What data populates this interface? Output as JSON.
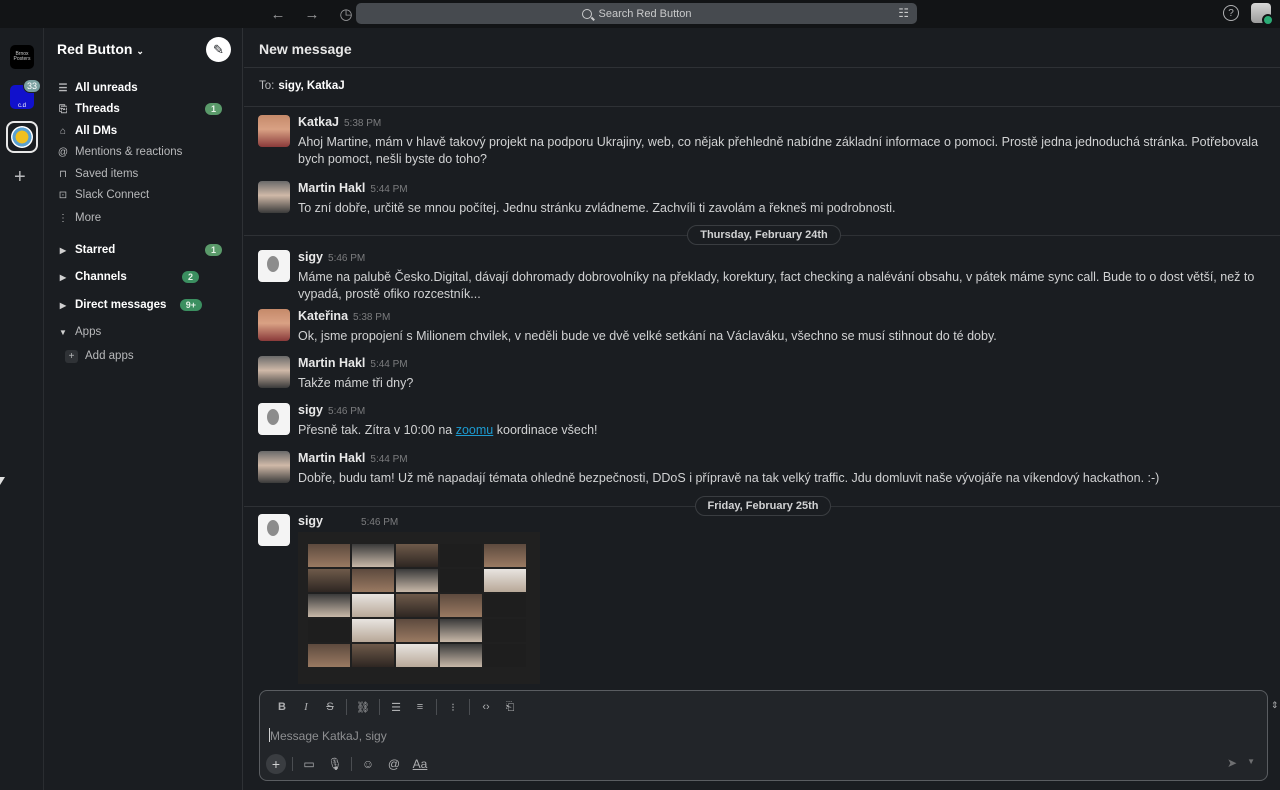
{
  "search": {
    "placeholder": "Search Red Button"
  },
  "workspaces": {
    "badge_count": "33",
    "ws1_text": "Brnox Posters",
    "ws2_text": "c.d"
  },
  "sidebar": {
    "workspace_name": "Red Button",
    "items": [
      {
        "label": "All unreads",
        "icon": "list-icon",
        "bold": true
      },
      {
        "label": "Threads",
        "icon": "threads-icon",
        "bold": true,
        "count": "1"
      },
      {
        "label": "All DMs",
        "icon": "dms-icon",
        "bold": true
      },
      {
        "label": "Mentions & reactions",
        "icon": "at-icon",
        "bold": false
      },
      {
        "label": "Saved items",
        "icon": "bookmark-icon",
        "bold": false
      },
      {
        "label": "Slack Connect",
        "icon": "connect-icon",
        "bold": false
      },
      {
        "label": "More",
        "icon": "more-icon",
        "bold": false
      }
    ],
    "sections": [
      {
        "label": "Starred",
        "count": "1"
      },
      {
        "label": "Channels",
        "count": "2"
      },
      {
        "label": "Direct messages",
        "count": "9+"
      },
      {
        "label": "Apps"
      }
    ],
    "add_apps": "Add apps"
  },
  "main": {
    "title": "New message",
    "to_label": "To:",
    "to_value": "sigy, KatkaJ"
  },
  "messages": [
    {
      "user": "KatkaJ",
      "time": "5:38 PM",
      "text": "Ahoj Martine, mám v hlavě takový projekt na podporu Ukrajiny, web, co nějak přehledně nabídne základní informace o pomoci. Prostě jedna jednoduchá stránka. Potřebovala bych pomoct, nešli byste do toho?"
    },
    {
      "user": "Martin Hakl",
      "time": "5:44 PM",
      "text": "To zní dobře, určitě se mnou počítej. Jednu stránku zvládneme. Zachvíli ti zavolám a řekneš mi podrobnosti."
    },
    {
      "user": "sigy",
      "time": "5:46 PM",
      "text": "Máme na palubě Česko.Digital, dávají dohromady dobrovolníky na překlady, korektury, fact checking a nalévání obsahu, v pátek máme sync call. Bude to o dost větší, než to vypadá, prostě ofiko rozcestník..."
    },
    {
      "user": "Kateřina",
      "time": "5:38 PM",
      "text": "Ok, jsme propojení s Milionem chvilek, v neděli bude ve dvě velké setkání na Václaváku, všechno se musí stihnout do té doby."
    },
    {
      "user": "Martin Hakl",
      "time": "5:44 PM",
      "text": "Takže máme tři dny?"
    },
    {
      "user": "sigy",
      "time": "5:46 PM",
      "text_before": "Přesně tak. Zítra v 10:00 na ",
      "link": "zoomu",
      "text_after": " koordinace všech!"
    },
    {
      "user": "Martin Hakl",
      "time": "5:44 PM",
      "text": "Dobře, budu tam! Už mě napadají témata ohledně bezpečnosti, DDoS i přípravě na tak velký traffic. Jdu domluvit naše vývojáře na víkendový hackathon. :-)"
    },
    {
      "user": "sigy",
      "time": "5:46 PM"
    }
  ],
  "day_dividers": [
    "Thursday, February 24th",
    "Friday, February 25th"
  ],
  "composer": {
    "placeholder": "Message KatkaJ, sigy",
    "format_buttons": [
      "B",
      "I",
      "S"
    ],
    "aa_label": "Aa"
  }
}
